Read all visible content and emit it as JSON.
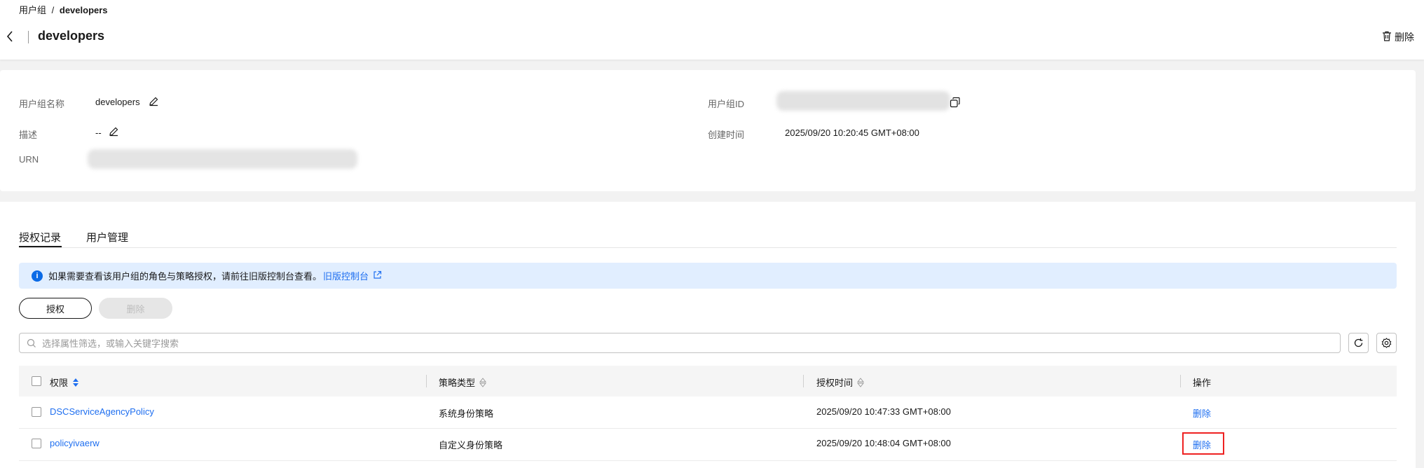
{
  "breadcrumb": {
    "parent": "用户组",
    "separator": "/",
    "current": "developers"
  },
  "header": {
    "title": "developers",
    "delete_label": "删除"
  },
  "info": {
    "name_label": "用户组名称",
    "name_value": "developers",
    "desc_label": "描述",
    "desc_value": "--",
    "urn_label": "URN",
    "id_label": "用户组ID",
    "created_label": "创建时间",
    "created_value": "2025/09/20 10:20:45 GMT+08:00"
  },
  "tabs": [
    {
      "label": "授权记录",
      "active": true
    },
    {
      "label": "用户管理",
      "active": false
    }
  ],
  "notice": {
    "text": "如果需要查看该用户组的角色与策略授权，请前往旧版控制台查看。",
    "link": "旧版控制台"
  },
  "actions": {
    "grant_label": "授权",
    "delete_label": "删除"
  },
  "search": {
    "placeholder": "选择属性筛选，或输入关键字搜索"
  },
  "table": {
    "columns": [
      "权限",
      "策略类型",
      "授权时间",
      "操作"
    ],
    "rows": [
      {
        "name": "DSCServiceAgencyPolicy",
        "type": "系统身份策略",
        "time": "2025/09/20 10:47:33 GMT+08:00",
        "action": "删除"
      },
      {
        "name": "policyivaerw",
        "type": "自定义身份策略",
        "time": "2025/09/20 10:48:04 GMT+08:00",
        "action": "删除"
      }
    ]
  },
  "colors": {
    "link": "#1f6ff0",
    "notice_bg": "#e1eeff",
    "highlight": "#ee2222"
  }
}
